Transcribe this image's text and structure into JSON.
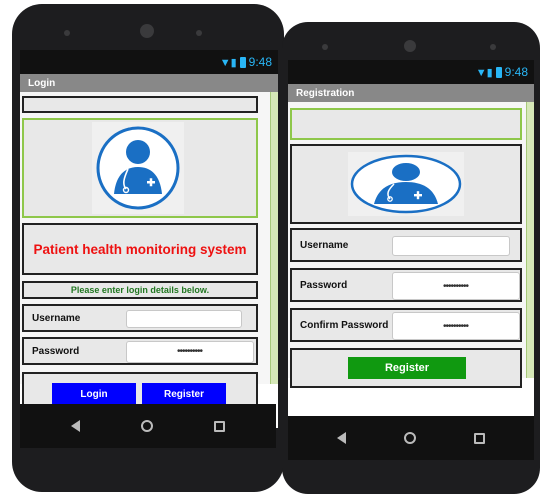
{
  "status": {
    "time": "9:48"
  },
  "login": {
    "title": "Login",
    "app_title": "Patient health monitoring system",
    "instruction": "Please enter login details below.",
    "username_label": "Username",
    "password_label": "Password",
    "password_value": "••••••••••",
    "login_button": "Login",
    "register_button": "Register"
  },
  "registration": {
    "title": "Registration",
    "username_label": "Username",
    "password_label": "Password",
    "confirm_password_label": "Confirm Password",
    "password_value": "••••••••••",
    "confirm_password_value": "••••••••••",
    "register_button": "Register"
  },
  "colors": {
    "login_button": "#0000ff",
    "register_button_login": "#0000ff",
    "register_button_reg": "#109910",
    "app_title": "#ee1111",
    "instruction": "#227722",
    "doctor_icon": "#1a6fc4"
  },
  "icons": {
    "nav_back": "back-icon",
    "nav_home": "home-icon",
    "nav_recent": "recent-apps-icon",
    "doctor": "doctor-icon"
  }
}
